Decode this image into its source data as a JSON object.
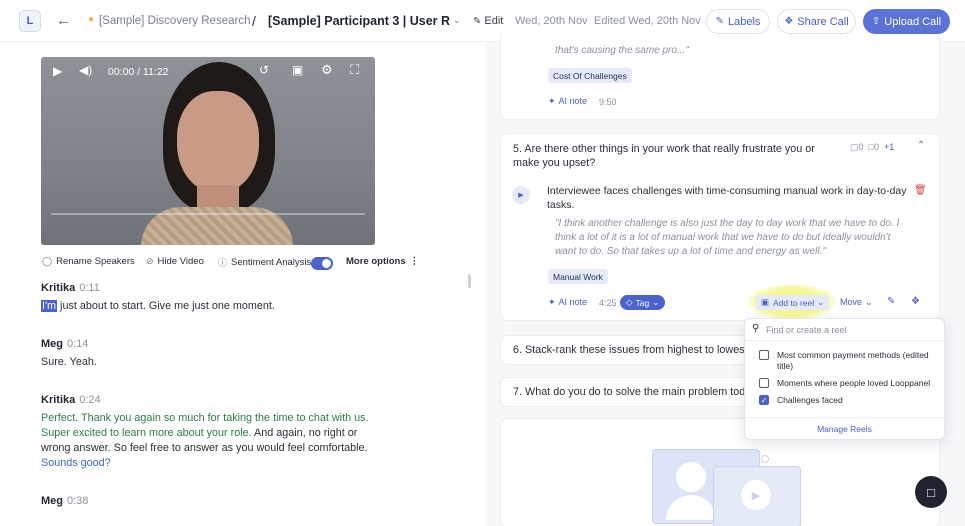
{
  "header": {
    "logo_letter": "L",
    "back_icon": "arrow-left-icon",
    "project_icon": "lightbulb-icon",
    "project_name": "[Sample] Discovery Research",
    "separator": "/",
    "call_title": "[Sample] Participant 3 | User Resea...",
    "edit_label": "Edit",
    "date": "Wed, 20th Nov",
    "edited": "Edited Wed, 20th Nov",
    "labels_btn": "Labels",
    "share_btn": "Share Call",
    "upload_btn": "Upload Call"
  },
  "video": {
    "time": "00:00 / 11:22"
  },
  "tools": {
    "rename": "Rename Speakers",
    "hide_video": "Hide Video",
    "sentiment": "Sentiment Analysis",
    "sentiment_on": true,
    "more": "More options"
  },
  "transcript": {
    "blocks": [
      {
        "speaker": "Kritika",
        "time": "0:11",
        "highlight": "I'm",
        "text": " just about to start. Give me just one moment."
      },
      {
        "speaker": "Meg",
        "time": "0:14",
        "text": "Sure. Yeah."
      },
      {
        "speaker": "Kritika",
        "time": "0:24",
        "green": "Perfect. Thank you again so much for taking the time to chat with us. Super excited to learn more about your role.",
        "plain": " And again, no right or wrong answer. So feel free to answer as you would feel comfortable.",
        "blue": " Sounds good?"
      },
      {
        "speaker": "Meg",
        "time": "0:38"
      }
    ]
  },
  "notes": {
    "top": {
      "quote_tail": "that's causing the same pro...\"",
      "tag": "Cost Of Challenges",
      "ai_label": "AI note",
      "time": "9:50"
    },
    "q5": {
      "question": "5. Are there other things in your work that really frustrate you or make you upset?",
      "clips": "0",
      "comments": "0",
      "plus": "+1",
      "summary": "Interviewee faces challenges with time-consuming manual work in day-to-day tasks.",
      "quote": "\"I think another challenge is also just the day to day work that we have to do. I think a lot of it is a lot of manual work that we have to do but ideally wouldn't want to do. So that takes up a lot of time and energy as well.\"",
      "tag": "Manual Work",
      "ai_label": "AI note",
      "time": "4:25",
      "tag_btn": "Tag",
      "add_reel": "Add to reel",
      "move": "Move"
    },
    "q6": "6. Stack-rank these issues from highest to lowest pr",
    "q7": "7. What do you do to solve the main problem today?"
  },
  "reel_dropdown": {
    "placeholder": "Find or create a reel",
    "items": [
      {
        "label": "Most common payment methods (edited title)",
        "checked": false
      },
      {
        "label": "Moments where people loved Looppanel",
        "checked": false
      },
      {
        "label": "Challenges faced",
        "checked": true
      }
    ],
    "manage": "Manage Reels"
  },
  "colors": {
    "accent": "#4a62cc",
    "highlight_glow": "#f3f57c",
    "positive": "#2e7a45"
  }
}
